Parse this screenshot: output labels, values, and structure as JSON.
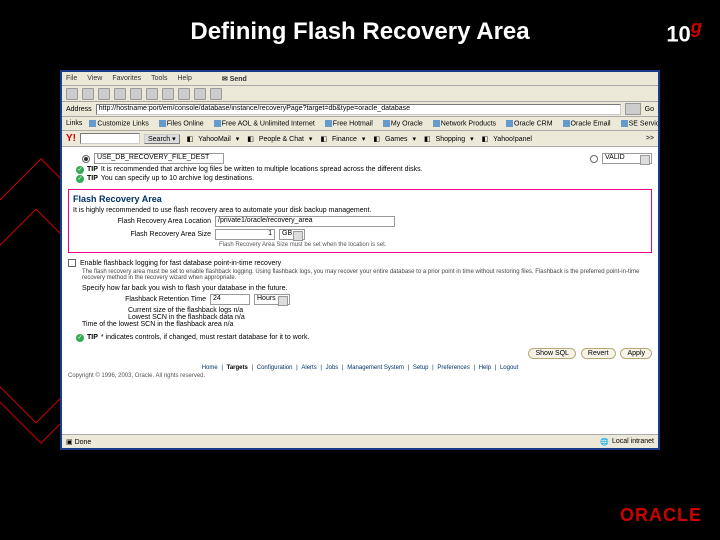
{
  "slide": {
    "title": "Defining Flash Recovery Area",
    "tenG": "10",
    "oracle": "ORACLE"
  },
  "browser": {
    "menu": {
      "file": "File",
      "view": "View",
      "favorites": "Favorites",
      "tools": "Tools",
      "help": "Help",
      "send": "Send"
    },
    "address": {
      "label": "Address",
      "url": "http://hostname:port/em/console/database/instance/recoveryPage?target=db&type=oracle_database",
      "go": "Go"
    },
    "links": {
      "label": "Links",
      "customize": "Customize Links",
      "files": "Files Online",
      "free": "Free AOL & Unlimited Internet",
      "hotmail": "Free Hotmail",
      "myoracle": "My Oracle",
      "netprod": "Network Products",
      "crm": "Oracle CRM",
      "email": "Oracle Email",
      "archive": "SE Service Archive"
    },
    "yahoo": {
      "logo": "Y!",
      "search": "Search",
      "mail": "YahooMail",
      "people": "People & Chat",
      "finance": "Finance",
      "games": "Games",
      "shopping": "Shopping",
      "yahoo": "Yahoo!panel",
      "more": ">>"
    },
    "statusbar": {
      "done": "Done",
      "zone": "Local intranet"
    }
  },
  "page": {
    "archOption1": "USE_DB_RECOVERY_FILE_DEST",
    "archOption2": "VALID",
    "tip1": {
      "b": "TIP",
      "t": "It is recommended that archive log files be written to multiple locations spread across the different disks."
    },
    "tip2": {
      "b": "TIP",
      "t": "You can specify up to 10 archive log destinations."
    },
    "flash": {
      "title": "Flash Recovery Area",
      "desc": "It is highly recommended to use flash recovery area to automate your disk backup management.",
      "locLabel": "Flash Recovery Area Location",
      "locVal": "/private1/oracle/recovery_area",
      "sizeLabel": "Flash Recovery Area Size",
      "sizeVal": "1",
      "sizeUnit": "GB",
      "note": "Flash Recovery Area Size must be set when the location is set."
    },
    "enable": {
      "label": "Enable flashback logging for fast database point-in-time recovery",
      "desc": "The flash recovery area must be set to enable flashback logging. Using flashback logs, you may recover your entire database to a prior point in time without restoring files. Flashback is the preferred point-in-time recovery method in the recovery wizard when appropriate."
    },
    "specify": "Specify how far back you wish to flash your database in the future.",
    "retLabel": "Flashback Retention Time",
    "retVal": "24",
    "retUnit": "Hours",
    "currSize": "Current size of the flashback logs n/a",
    "lowestSCN": "Lowest SCN in the flashback data n/a",
    "lowestTime": "Time of the lowest SCN in the flashback area n/a",
    "tip3": {
      "b": "TIP",
      "t": "* indicates controls, if changed, must restart database for it to work."
    },
    "buttons": {
      "showSQL": "Show SQL",
      "revert": "Revert",
      "apply": "Apply"
    },
    "footnav": {
      "home": "Home",
      "targets": "Targets",
      "config": "Configuration",
      "alerts": "Alerts",
      "jobs": "Jobs",
      "mgmt": "Management System",
      "setup": "Setup",
      "prefs": "Preferences",
      "help": "Help",
      "logout": "Logout"
    },
    "copyright": "Copyright © 1996, 2003, Oracle. All rights reserved."
  }
}
